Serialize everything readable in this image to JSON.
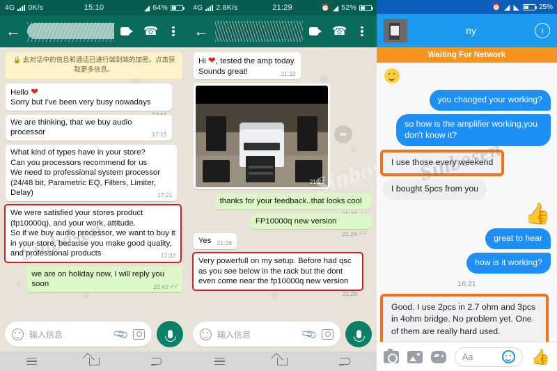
{
  "panels": {
    "left": {
      "status": {
        "network": "4G",
        "speed": "0K/s",
        "time": "15:10",
        "battery": "64%"
      },
      "appbar": {
        "back_icon": "back-arrow-icon",
        "video_icon": "video-call-icon",
        "phone_icon": "voice-call-icon",
        "menu_icon": "overflow-menu-icon",
        "contact_name": ""
      },
      "encryption_notice": "🔒 此对话中的信息和通话已进行端到端的加密。点击获取更多信息。",
      "messages": [
        {
          "dir": "in",
          "text": "Hello ❤\nSorry but I've been very busy nowadays",
          "time": "17:15",
          "highlight": false
        },
        {
          "dir": "in",
          "text": "We are thinking, that we buy audio processor",
          "time": "17:15",
          "highlight": false
        },
        {
          "dir": "in",
          "text": "What kind of types have in your store?\nCan you processors recommend for us\nWe need to professional system processor (24/48 bit, Parametric EQ, Filters, Limiter, Delay)",
          "time": "17:21",
          "highlight": false
        },
        {
          "dir": "in",
          "text": "We were satisfied your stores product (fp10000q), and your work, attitude.\nSo if we buy audio processor, we want to buy it in your store, because you make good quality, and professional products",
          "time": "17:32",
          "highlight": true
        },
        {
          "dir": "out",
          "text": "we are on holiday now, I will reply you soon",
          "time": "20:42",
          "highlight": false,
          "read": true
        }
      ],
      "input": {
        "placeholder": "输入信息",
        "emoji_icon": "emoji-icon",
        "attach_icon": "paperclip-icon",
        "camera_icon": "camera-icon",
        "mic_icon": "microphone-icon"
      },
      "nav": {
        "recent": "recent-apps-icon",
        "home": "home-icon",
        "back": "back-icon"
      }
    },
    "middle": {
      "status": {
        "network": "4G",
        "speed": "2.8K/s",
        "time": "21:29",
        "battery": "52%",
        "alarm_icon": "alarm-icon"
      },
      "appbar": {
        "back_icon": "back-arrow-icon",
        "video_icon": "video-call-icon",
        "phone_icon": "voice-call-icon",
        "menu_icon": "overflow-menu-icon",
        "contact_name": ""
      },
      "messages": [
        {
          "dir": "in",
          "type": "text",
          "text": "Hi ❤, tested the amp today.\nSounds great!",
          "time": "21:22",
          "highlight": false
        },
        {
          "dir": "in",
          "type": "photo",
          "caption": "photo of van with speakers and amplifier rack in garage",
          "time": "21:23",
          "forward_icon": "forward-arrow-icon"
        },
        {
          "dir": "out",
          "type": "text",
          "text": "thanks for your feedback..that looks cool",
          "time": "21:24",
          "highlight": false,
          "read": true
        },
        {
          "dir": "out",
          "type": "text",
          "text": "FP10000q new version",
          "time": "21:24",
          "highlight": false,
          "read": true
        },
        {
          "dir": "in",
          "type": "text",
          "text": "Yes",
          "time": "21:26",
          "highlight": false
        },
        {
          "dir": "in",
          "type": "text",
          "text": "Very powerfull on my setup. Before had qsc as you see below in the rack but the dont even come near the fp10000q new version",
          "time": "21:28",
          "highlight": true
        }
      ],
      "input": {
        "placeholder": "输入信息",
        "emoji_icon": "emoji-icon",
        "attach_icon": "paperclip-icon",
        "camera_icon": "camera-icon",
        "mic_icon": "microphone-icon"
      },
      "nav": {
        "recent": "recent-apps-icon",
        "home": "home-icon",
        "back": "back-icon"
      }
    },
    "right": {
      "status": {
        "battery": "25%",
        "alarm_icon": "alarm-icon",
        "wifi_icon": "wifi-icon",
        "signal_icon": "signal-icon"
      },
      "appbar": {
        "title": "ny",
        "info_icon": "info-icon",
        "avatar": "contact-avatar"
      },
      "banner": "Waiting For Network",
      "messages": [
        {
          "dir": "in",
          "type": "emoji",
          "text": "🙂"
        },
        {
          "dir": "out",
          "type": "text",
          "text": "you changed your working?"
        },
        {
          "dir": "out",
          "type": "text",
          "text": "so how is the amplifier working,you don't know it?"
        },
        {
          "dir": "in",
          "type": "text",
          "text": "I use those every weekend",
          "highlight": true
        },
        {
          "dir": "in",
          "type": "text",
          "text": "I bought 5pcs from you"
        },
        {
          "dir": "out",
          "type": "sticker",
          "text": "👍"
        },
        {
          "dir": "out",
          "type": "text",
          "text": "great to hear"
        },
        {
          "dir": "out",
          "type": "text",
          "text": "how is it working?"
        }
      ],
      "timestamp": "16:21",
      "reply": {
        "text": "Good. I use 2pcs in 2.7 ohm and 3pcs in 4ohm bridge. No problem yet. One of them are really hard used.",
        "highlight": true
      },
      "input": {
        "placeholder": "Aa",
        "camera_icon": "camera-icon",
        "gallery_icon": "gallery-icon",
        "game_icon": "game-controller-icon",
        "emoji_icon": "emoji-icon",
        "like_icon": "thumbs-up-icon"
      }
    }
  },
  "watermark": "Sinbosen",
  "colors": {
    "whatsapp_header": "#0a6b5c",
    "whatsapp_out": "#dcf8c6",
    "messenger_blue": "#1e8ff5",
    "banner_orange": "#f7941e",
    "highlight_red": "#cc1f1f",
    "highlight_orange": "#f0711a"
  }
}
